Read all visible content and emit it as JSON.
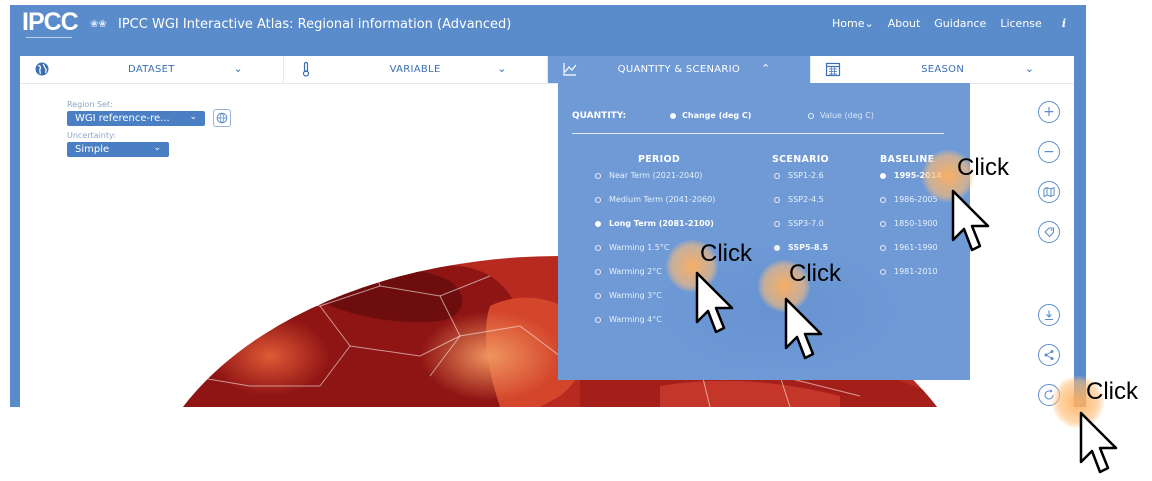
{
  "header": {
    "logo_text": "IPCC",
    "title": "IPCC WGI Interactive Atlas: Regional information (Advanced)",
    "nav": [
      "Home",
      "About",
      "Guidance",
      "License"
    ],
    "info_icon": "info-icon"
  },
  "selectors": [
    {
      "label": "DATASET",
      "icon": "globe-icon",
      "chevron": "chevron-down-icon"
    },
    {
      "label": "VARIABLE",
      "icon": "thermometer-icon",
      "chevron": "chevron-down-icon"
    },
    {
      "label": "QUANTITY & SCENARIO",
      "icon": "line-chart-icon",
      "chevron": "chevron-up-icon"
    },
    {
      "label": "SEASON",
      "icon": "calendar-icon",
      "chevron": "chevron-down-icon"
    }
  ],
  "controls": {
    "region_set_label": "Region Set:",
    "region_set_value": "WGI reference-re...",
    "uncertainty_label": "Uncertainty:",
    "uncertainty_value": "Simple"
  },
  "panel": {
    "quantity_label": "QUANTITY:",
    "quantity_options": [
      {
        "label": "Change (deg C)",
        "selected": true
      },
      {
        "label": "Value (deg C)",
        "selected": false
      }
    ],
    "period_header": "PERIOD",
    "scenario_header": "SCENARIO",
    "baseline_header": "BASELINE",
    "periods": [
      {
        "label": "Near Term (2021-2040)",
        "selected": false
      },
      {
        "label": "Medium Term (2041-2060)",
        "selected": false
      },
      {
        "label": "Long Term (2081-2100)",
        "selected": true
      },
      {
        "label": "Warming 1.5°C",
        "selected": false
      },
      {
        "label": "Warming 2°C",
        "selected": false
      },
      {
        "label": "Warming 3°C",
        "selected": false
      },
      {
        "label": "Warming 4°C",
        "selected": false
      }
    ],
    "scenarios": [
      {
        "label": "SSP1-2.6",
        "selected": false
      },
      {
        "label": "SSP2-4.5",
        "selected": false
      },
      {
        "label": "SSP3-7.0",
        "selected": false
      },
      {
        "label": "SSP5-8.5",
        "selected": true
      }
    ],
    "baselines": [
      {
        "label": "1995-2014",
        "selected": true
      },
      {
        "label": "1986-2005",
        "selected": false
      },
      {
        "label": "1850-1900",
        "selected": false
      },
      {
        "label": "1961-1990",
        "selected": false
      },
      {
        "label": "1981-2010",
        "selected": false
      }
    ]
  },
  "tools": [
    "zoom-in-icon",
    "zoom-out-icon",
    "map-layers-icon",
    "tag-icon",
    "download-icon",
    "share-icon",
    "reset-icon"
  ],
  "annotations": {
    "click_label": "Click"
  },
  "colors": {
    "header_blue": "#5a8ccc",
    "panel_blue": "#6f9ad6",
    "map_dark": "#7a0e0e",
    "map_mid": "#b3261e",
    "map_light": "#e8603c",
    "click_orange": "#ffb060"
  }
}
